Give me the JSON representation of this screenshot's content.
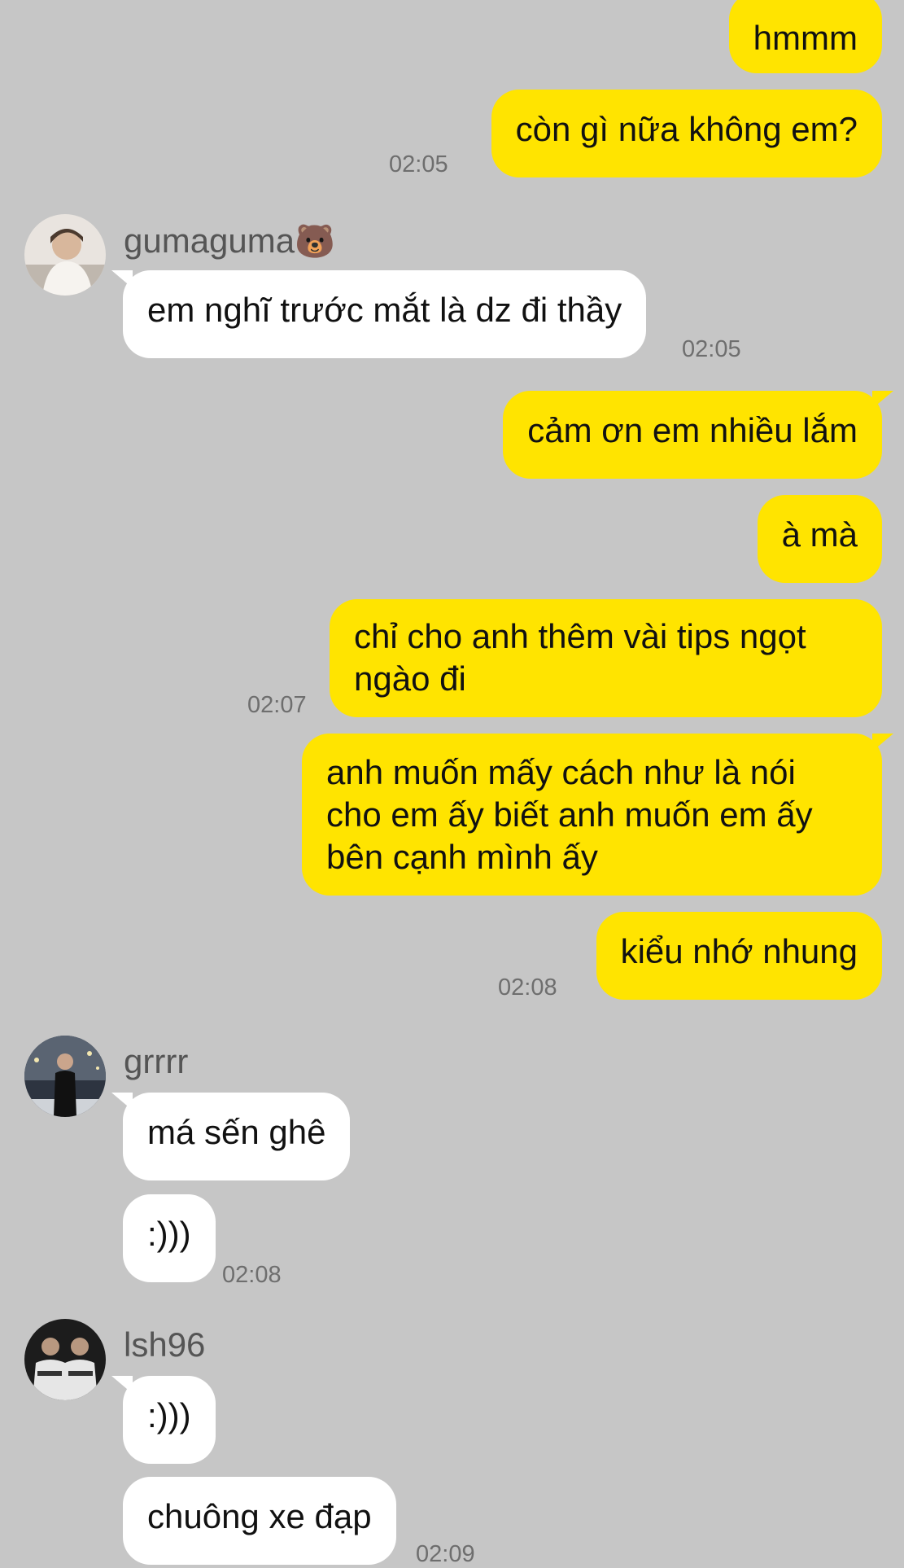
{
  "colors": {
    "background": "#c6c6c6",
    "outgoing_bubble": "#ffe400",
    "incoming_bubble": "#ffffff",
    "timestamp": "#6e6e6e",
    "sender_name": "#555555"
  },
  "messages_out_1": {
    "m1": "hmmm",
    "m2": "còn gì nữa không em?",
    "time": "02:05"
  },
  "group_guma": {
    "sender": "gumaguma",
    "sender_emoji": "🐻",
    "avatar_icon": "user-avatar-photo",
    "m1": "em nghĩ trước mắt là dz đi thầy",
    "time": "02:05"
  },
  "messages_out_2": {
    "m1": "cảm ơn em nhiều lắm",
    "m2": "à mà",
    "m3": "chỉ cho anh thêm vài tips ngọt ngào đi",
    "time1": "02:07",
    "m4": "anh muốn mấy cách như là nói cho em ấy biết anh muốn em ấy bên cạnh mình ấy",
    "m5": "kiểu nhớ nhung",
    "time2": "02:08"
  },
  "group_grrrr": {
    "sender": "grrrr",
    "avatar_icon": "user-avatar-photo",
    "m1": "má sến ghê",
    "m2": ":)))",
    "time": "02:08"
  },
  "group_lsh": {
    "sender": "lsh96",
    "avatar_icon": "user-avatar-photo",
    "m1": ":)))",
    "m2": "chuông xe đạp",
    "time": "02:09"
  }
}
